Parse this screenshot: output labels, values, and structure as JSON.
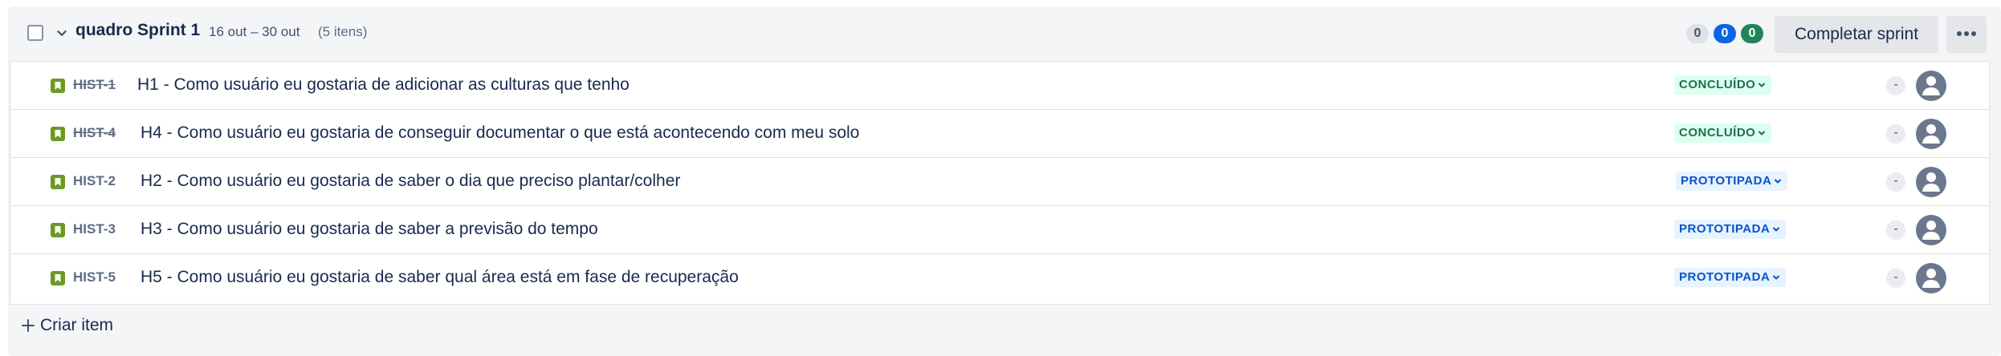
{
  "sprint": {
    "title": "quadro Sprint 1",
    "dates": "16 out – 30 out",
    "count": "(5 itens)",
    "status_counts": {
      "todo": "0",
      "in_progress": "0",
      "done": "0"
    },
    "complete_label": "Completar sprint"
  },
  "issues": [
    {
      "key": "HIST-1",
      "summary": "H1 - Como usuário eu gostaria de adicionar as culturas que tenho",
      "status": "CONCLUÍDO",
      "estimate": "-",
      "done": true
    },
    {
      "key": "HIST-4",
      "summary": "H4 - Como usuário eu gostaria de conseguir documentar o que está acontecendo com meu solo",
      "status": "CONCLUÍDO",
      "estimate": "-",
      "done": true
    },
    {
      "key": "HIST-2",
      "summary": "H2 - Como usuário eu gostaria de saber o dia que preciso plantar/colher",
      "status": "PROTOTIPADA",
      "estimate": "-",
      "done": false
    },
    {
      "key": "HIST-3",
      "summary": "H3 - Como usuário eu gostaria de saber a previsão do tempo",
      "status": "PROTOTIPADA",
      "estimate": "-",
      "done": false
    },
    {
      "key": "HIST-5",
      "summary": "H5 - Como usuário eu gostaria de saber qual área está em fase de recuperação",
      "status": "PROTOTIPADA",
      "estimate": "-",
      "done": false
    }
  ],
  "footer": {
    "create_label": "Criar item"
  },
  "colors": {
    "story_icon": "#6a9a23",
    "done_status_bg": "#dcfff1",
    "done_status_text": "#216e4e",
    "proto_status_bg": "#e9f2ff",
    "proto_status_text": "#0055cc",
    "in_progress_pill": "#0c66e4",
    "done_pill": "#1f845a"
  },
  "icons": {
    "expand": "chevron-down-icon",
    "issue_type": "story-bookmark-icon",
    "assignee": "user-avatar-icon",
    "more": "more-horizontal-icon",
    "create": "plus-icon"
  }
}
